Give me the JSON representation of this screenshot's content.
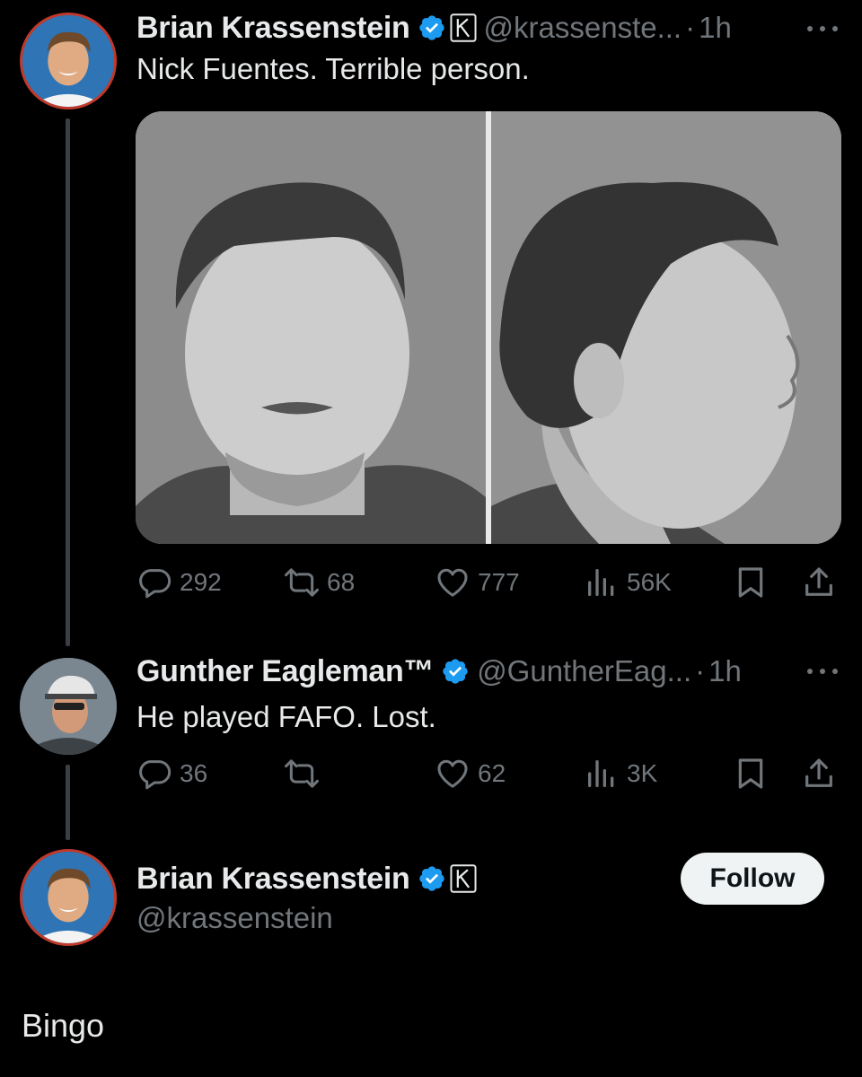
{
  "tweet1": {
    "author": "Brian Krassenstein",
    "handle": "@krassenste...",
    "time": "1h",
    "text": "Nick Fuentes. Terrible person.",
    "stats": {
      "replies": "292",
      "reposts": "68",
      "likes": "777",
      "views": "56K"
    }
  },
  "tweet2": {
    "author": "Gunther Eagleman™",
    "handle": "@GuntherEag...",
    "time": "1h",
    "text": "He played FAFO.  Lost.",
    "stats": {
      "replies": "36",
      "reposts": "",
      "likes": "62",
      "views": "3K"
    }
  },
  "reply": {
    "author": "Brian Krassenstein",
    "handle": "@krassenstein",
    "follow_label": "Follow",
    "text": "Bingo"
  },
  "separator": "·",
  "colors": {
    "background": "#000000",
    "primary_text": "#e7e9ea",
    "secondary_text": "#71767b",
    "verified_blue": "#1d9bf0",
    "follow_bg": "#eff3f4"
  },
  "icons": [
    "verified-badge-icon",
    "k-affiliate-icon",
    "more-icon",
    "reply-icon",
    "repost-icon",
    "like-icon",
    "views-icon",
    "bookmark-icon",
    "share-icon"
  ]
}
